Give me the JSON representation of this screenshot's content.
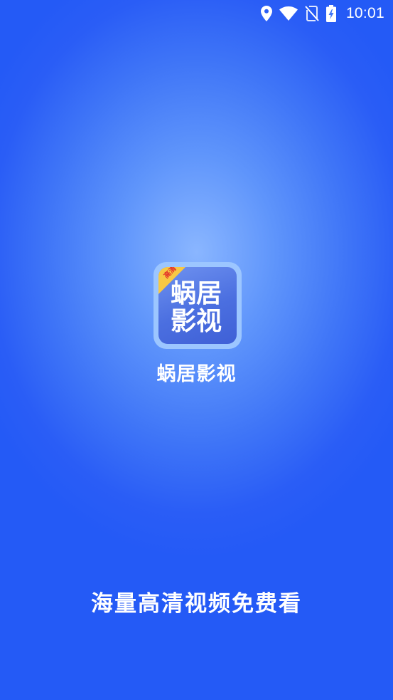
{
  "status_bar": {
    "time": "10:01",
    "icons": [
      "location-icon",
      "wifi-icon",
      "no-sim-icon",
      "battery-charging-icon"
    ]
  },
  "logo": {
    "badge_text": "高清",
    "line1": "蜗居",
    "line2": "影视"
  },
  "app_name": "蜗居影视",
  "slogan": "海量高清视频免费看",
  "colors": {
    "background_center": "#8ab6ff",
    "background_edge": "#245af6",
    "logo_frame": "#9cc6ff",
    "logo_fill": "#4b6fe0",
    "badge": "#f7c844",
    "badge_text": "#e3332a",
    "text": "#ffffff"
  }
}
